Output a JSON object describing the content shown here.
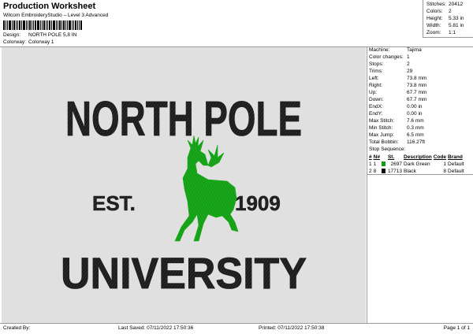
{
  "header": {
    "title": "Production Worksheet",
    "subtitle": "Wilcom EmbroideryStudio – Level 3 Advanced",
    "design_label": "Design:",
    "design_value": "NORTH POLE 5,8 IN",
    "colorway_label": "Colorway:",
    "colorway_value": "Colorway 1"
  },
  "summary": [
    {
      "label": "Stitches:",
      "value": "20412"
    },
    {
      "label": "Colors:",
      "value": "2"
    },
    {
      "label": "Height:",
      "value": "5.33 in"
    },
    {
      "label": "Width:",
      "value": "5.81 in"
    },
    {
      "label": "Zoom:",
      "value": "1:1"
    }
  ],
  "design": {
    "line1": "NORTH POLE",
    "est": "EST.",
    "year": "1909",
    "line3": "UNIVERSITY",
    "colors": {
      "text": "#1c1c1c",
      "deer": "#18a81a",
      "background": "#e0e0e0"
    }
  },
  "details": [
    {
      "label": "Machine:",
      "value": "Tajima"
    },
    {
      "label": "Color changes:",
      "value": "1"
    },
    {
      "label": "Stops:",
      "value": "2"
    },
    {
      "label": "Trims:",
      "value": "29"
    },
    {
      "label": "Left:",
      "value": "73.8 mm"
    },
    {
      "label": "Right:",
      "value": "73.8 mm"
    },
    {
      "label": "Up:",
      "value": "67.7 mm"
    },
    {
      "label": "Down:",
      "value": "67.7 mm"
    },
    {
      "label": "EndX:",
      "value": "0.00 in"
    },
    {
      "label": "EndY:",
      "value": "0.00 in"
    },
    {
      "label": "Max Stitch:",
      "value": "7.6 mm"
    },
    {
      "label": "Min Stitch:",
      "value": "0.3 mm"
    },
    {
      "label": "Max Jump:",
      "value": "6.5 mm"
    },
    {
      "label": "Total Bobbin:",
      "value": "116.27ft"
    }
  ],
  "stop_sequence": {
    "title": "Stop Sequence:",
    "headers": [
      "#",
      "N#",
      "",
      "St.",
      "Description",
      "Code",
      "Brand"
    ],
    "rows": [
      {
        "num": "1",
        "needle": "1",
        "color": "#139a1a",
        "stitches": "2697",
        "description": "Dark Green",
        "code": "1",
        "brand": "Default"
      },
      {
        "num": "2",
        "needle": "8",
        "color": "#111111",
        "stitches": "17713",
        "description": "Black",
        "code": "8",
        "brand": "Default"
      }
    ]
  },
  "footer": {
    "created_by": "Created By:",
    "last_saved": "Last Saved: 07/11/2022 17:50:36",
    "printed": "Printed: 07/11/2022 17:50:38",
    "page": "Page 1 of 1"
  }
}
